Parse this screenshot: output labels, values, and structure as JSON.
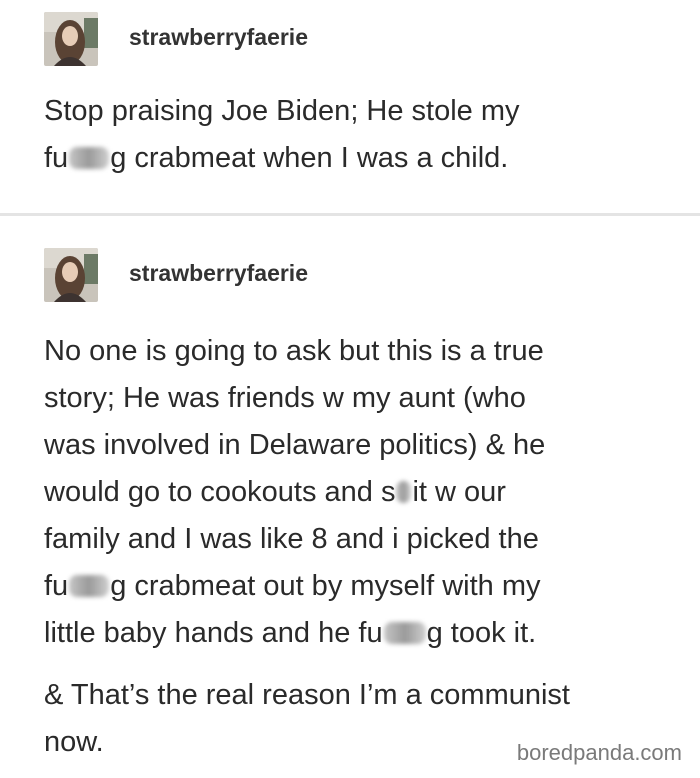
{
  "posts": [
    {
      "username": "strawberryfaerie",
      "lines": [
        {
          "pre": "Stop praising Joe Biden; He stole my"
        },
        {
          "pre": "fu",
          "post": "g crabmeat when I was a child."
        }
      ]
    },
    {
      "username": "strawberryfaerie",
      "lines": [
        {
          "pre": "No one is going to ask but this is a true"
        },
        {
          "pre": "story; He was friends w my aunt (who"
        },
        {
          "pre": "was involved in Delaware politics) & he"
        },
        {
          "pre": "would go to cookouts and s",
          "post": "it w our"
        },
        {
          "pre": "family and I was like 8 and i picked the"
        },
        {
          "pre": "fu",
          "post": "g crabmeat out by myself with my"
        },
        {
          "pre": "little baby hands and he fu",
          "post": "g took it."
        },
        {
          "pre": "& That’s the real reason I’m a communist"
        },
        {
          "pre": "now."
        }
      ]
    }
  ],
  "watermark": "boredpanda.com",
  "icons": {
    "avatar": "user-photo-avatar"
  },
  "colors": {
    "text": "#2a2a2a",
    "divider": "#e4e4e4",
    "watermark": "#7a7a7a"
  }
}
